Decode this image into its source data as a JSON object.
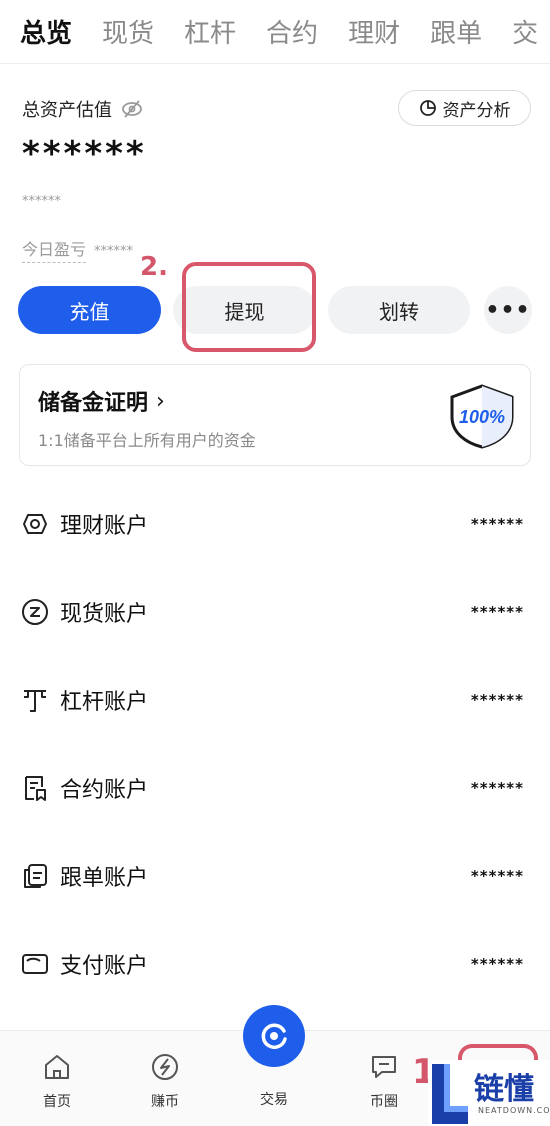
{
  "tabs": [
    {
      "label": "总览",
      "active": true
    },
    {
      "label": "现货",
      "active": false
    },
    {
      "label": "杠杆",
      "active": false
    },
    {
      "label": "合约",
      "active": false
    },
    {
      "label": "理财",
      "active": false
    },
    {
      "label": "跟单",
      "active": false
    },
    {
      "label": "交",
      "active": false
    }
  ],
  "overview": {
    "total_label": "总资产估值",
    "analysis_label": "资产分析",
    "total_value": "******",
    "sub_value": "******",
    "pnl_label": "今日盈亏",
    "pnl_value": "******"
  },
  "actions": {
    "deposit": "充值",
    "withdraw": "提现",
    "transfer": "划转",
    "more": "•••"
  },
  "reserve": {
    "title": "储备金证明",
    "chevron": "›",
    "desc": "1:1储备平台上所有用户的资金",
    "badge": "100%"
  },
  "accounts": [
    {
      "label": "理财账户",
      "value": "******",
      "icon": "finance-icon"
    },
    {
      "label": "现货账户",
      "value": "******",
      "icon": "spot-icon"
    },
    {
      "label": "杠杆账户",
      "value": "******",
      "icon": "margin-icon"
    },
    {
      "label": "合约账户",
      "value": "******",
      "icon": "contract-icon"
    },
    {
      "label": "跟单账户",
      "value": "******",
      "icon": "copy-trade-icon"
    },
    {
      "label": "支付账户",
      "value": "******",
      "icon": "payment-icon"
    }
  ],
  "nav": {
    "home": "首页",
    "earn": "赚币",
    "trade": "交易",
    "community": "币圈"
  },
  "annotations": {
    "step1": "1",
    "step2": "2."
  },
  "watermark": {
    "text": "链懂",
    "sub": "NEATDOWN.COM"
  },
  "colors": {
    "accent": "#1f5eea",
    "annotation": "#d9576b"
  }
}
